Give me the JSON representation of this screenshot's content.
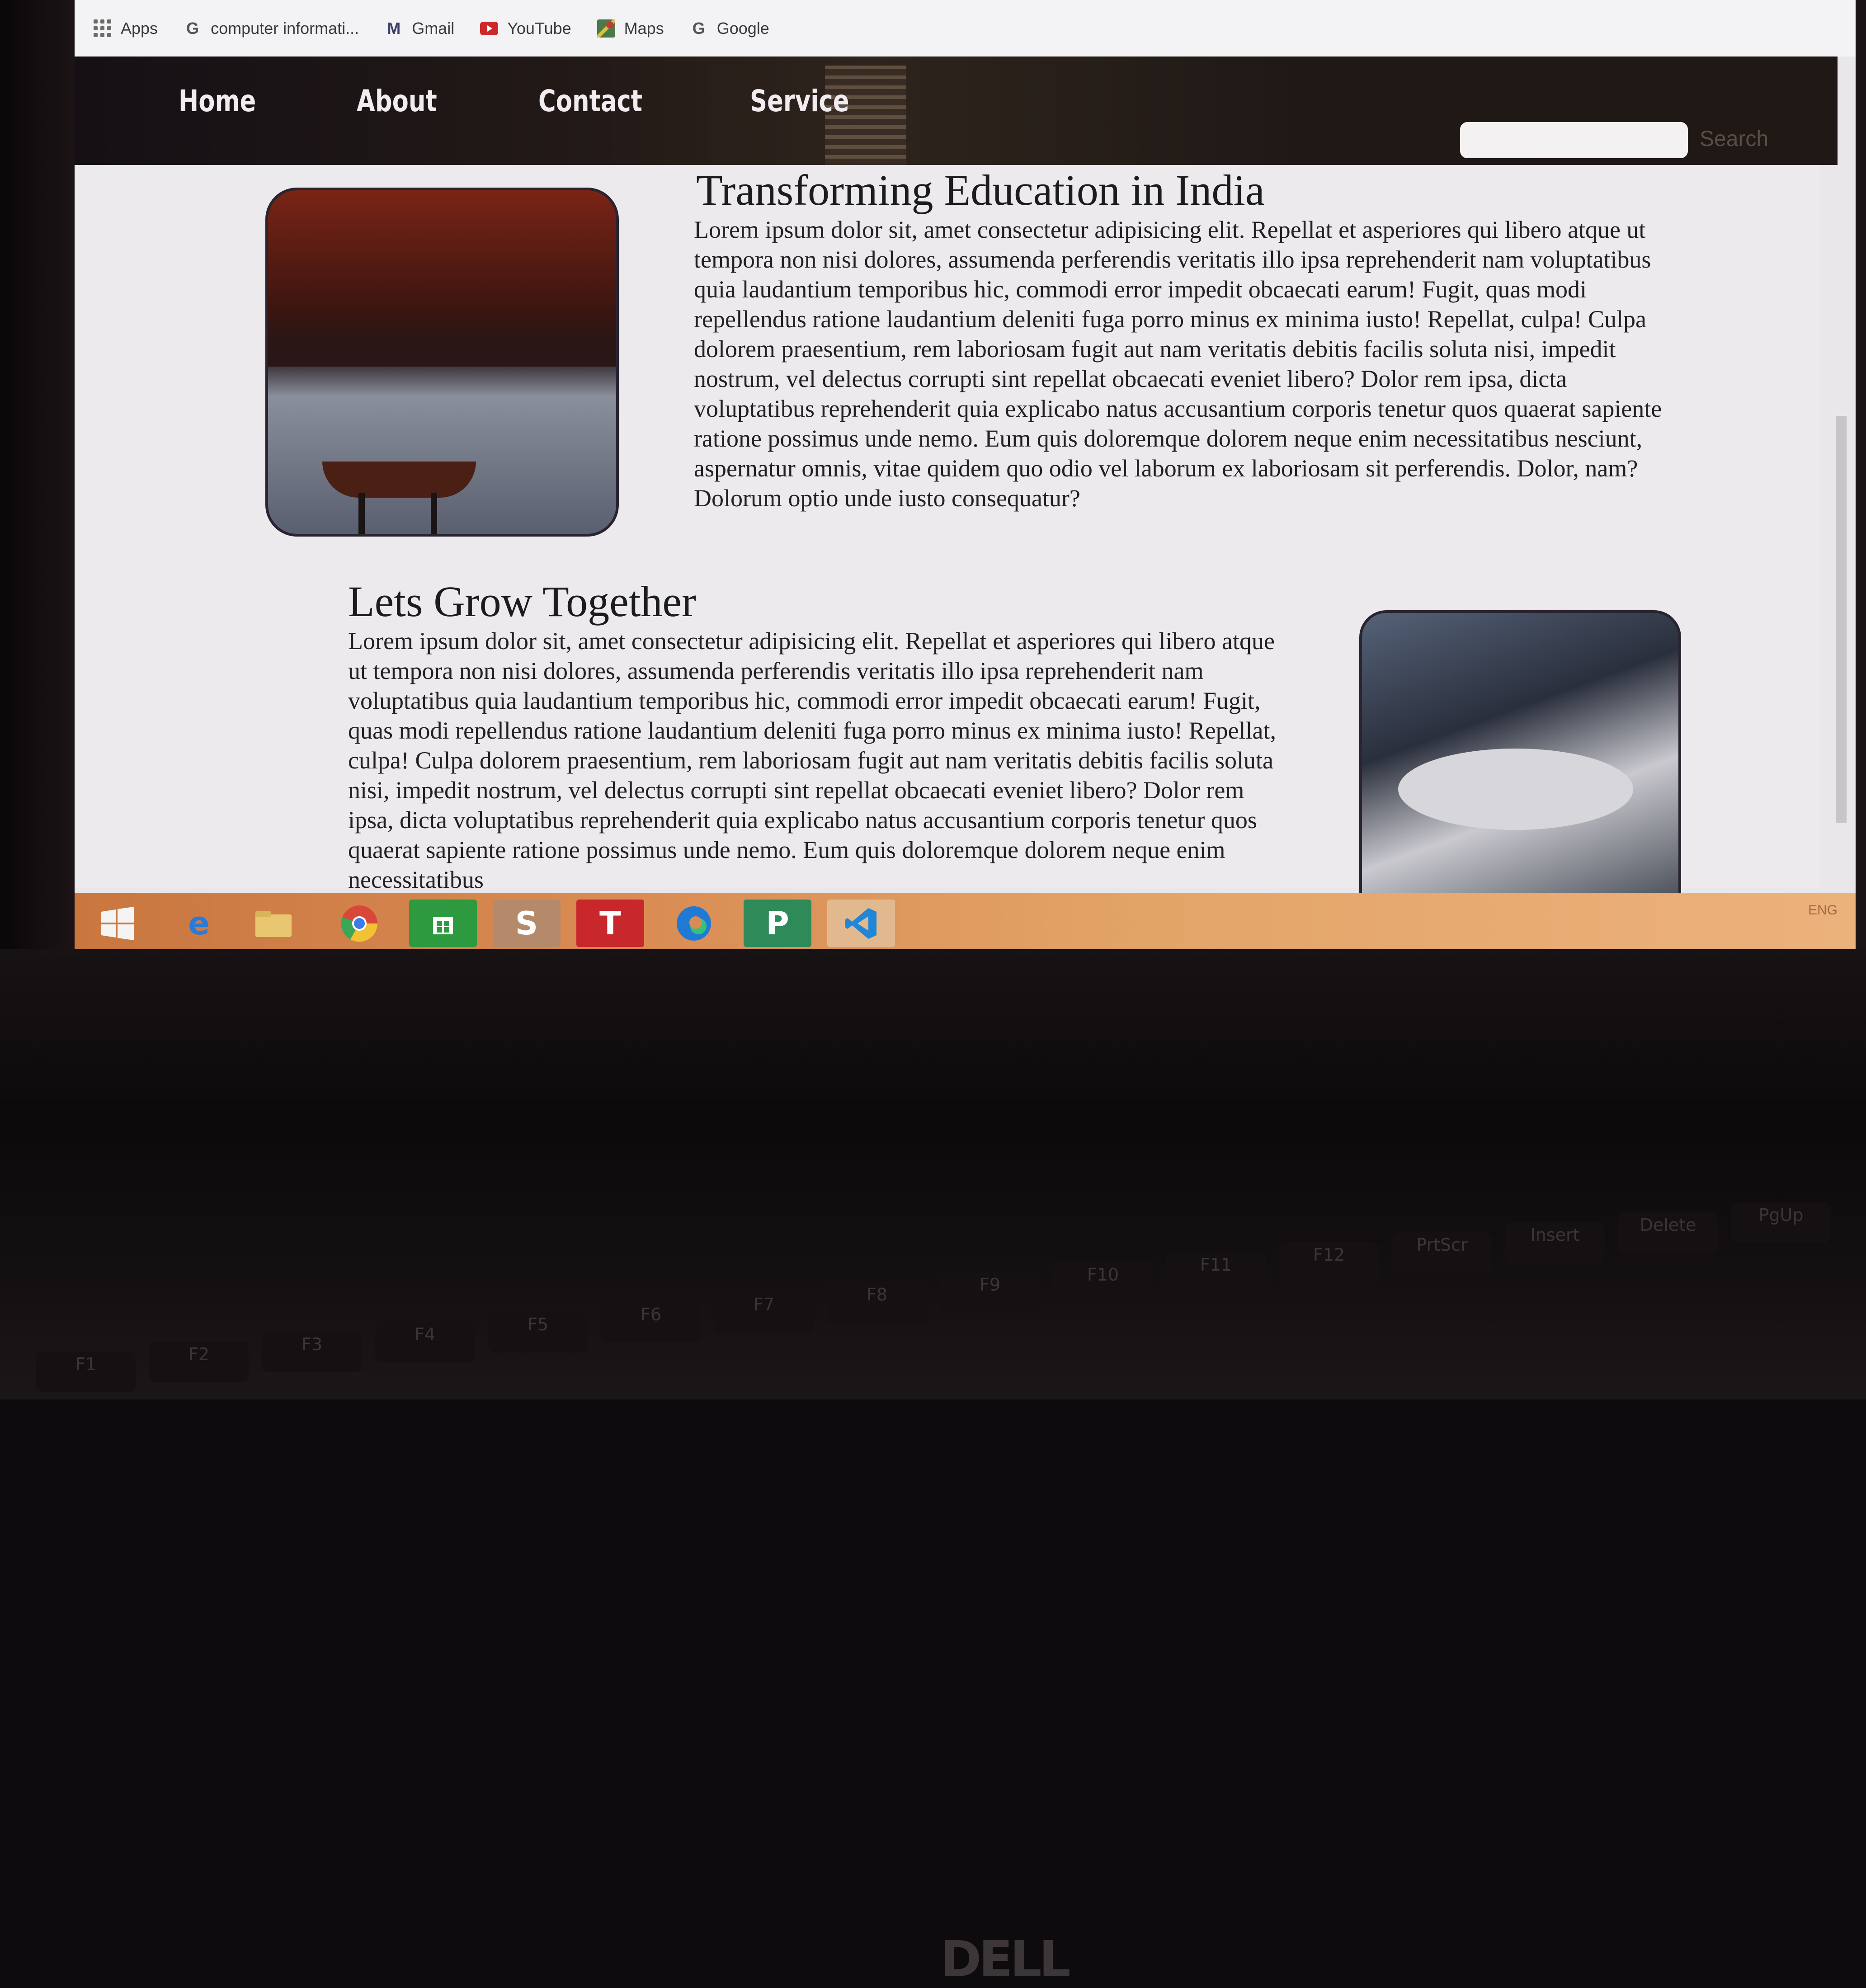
{
  "bookmarks": [
    {
      "label": "Apps",
      "icon": "apps-grid-icon"
    },
    {
      "label": "computer informati...",
      "icon": "google-g-icon"
    },
    {
      "label": "Gmail",
      "icon": "gmail-icon"
    },
    {
      "label": "YouTube",
      "icon": "youtube-icon"
    },
    {
      "label": "Maps",
      "icon": "maps-icon"
    },
    {
      "label": "Google",
      "icon": "google-g-icon"
    }
  ],
  "nav": {
    "home": "Home",
    "about": "About",
    "contact": "Contact",
    "service": "Service",
    "search_button": "Search"
  },
  "section1": {
    "title": "Transforming Education in India",
    "body": "Lorem ipsum dolor sit, amet consectetur adipisicing elit. Repellat et asperiores qui libero atque ut tempora non nisi dolores, assumenda perferendis veritatis illo ipsa reprehenderit nam voluptatibus quia laudantium temporibus hic, commodi error impedit obcaecati earum! Fugit, quas modi repellendus ratione laudantium deleniti fuga porro minus ex minima iusto! Repellat, culpa! Culpa dolorem praesentium, rem laboriosam fugit aut nam veritatis debitis facilis soluta nisi, impedit nostrum, vel delectus corrupti sint repellat obcaecati eveniet libero? Dolor rem ipsa, dicta voluptatibus reprehenderit quia explicabo natus accusantium corporis tenetur quos quaerat sapiente ratione possimus unde nemo. Eum quis doloremque dolorem neque enim necessitatibus nesciunt, aspernatur omnis, vitae quidem quo odio vel laborum ex laboriosam sit perferendis. Dolor, nam? Dolorum optio unde iusto consequatur?"
  },
  "section2": {
    "title": "Lets Grow Together",
    "body": "Lorem ipsum dolor sit, amet consectetur adipisicing elit. Repellat et asperiores qui libero atque ut tempora non nisi dolores, assumenda perferendis veritatis illo ipsa reprehenderit nam voluptatibus quia laudantium temporibus hic, commodi error impedit obcaecati earum! Fugit, quas modi repellendus ratione laudantium deleniti fuga porro minus ex minima iusto! Repellat, culpa! Culpa dolorem praesentium, rem laboriosam fugit aut nam veritatis debitis facilis soluta nisi, impedit nostrum, vel delectus corrupti sint repellat obcaecati eveniet libero? Dolor rem ipsa, dicta voluptatibus reprehenderit quia explicabo natus accusantium corporis tenetur quos quaerat sapiente ratione possimus unde nemo. Eum quis doloremque dolorem neque enim necessitatibus"
  },
  "taskbar": {
    "items": [
      {
        "name": "windows-start-icon",
        "glyph": ""
      },
      {
        "name": "internet-explorer-icon",
        "glyph": "e"
      },
      {
        "name": "file-explorer-icon",
        "glyph": ""
      },
      {
        "name": "chrome-icon",
        "glyph": ""
      },
      {
        "name": "store-icon",
        "glyph": ""
      },
      {
        "name": "sway-icon",
        "glyph": "S"
      },
      {
        "name": "typing-app-icon",
        "glyph": "T"
      },
      {
        "name": "edge-icon",
        "glyph": ""
      },
      {
        "name": "project-icon",
        "glyph": "P"
      },
      {
        "name": "vscode-icon",
        "glyph": ""
      }
    ],
    "tray_lang": "ENG"
  },
  "hardware": {
    "brand": "DELL",
    "fkeys": [
      "F1",
      "F2",
      "F3",
      "F4",
      "F5",
      "F6",
      "F7",
      "F8",
      "F9",
      "F10",
      "F11",
      "F12",
      "PrtScr",
      "Insert",
      "Delete",
      "PgUp"
    ]
  },
  "colors": {
    "header_bg": "#231a17",
    "nav_text": "#f1ecef",
    "taskbar": "#d88b52",
    "page_bg": "#eceaec"
  }
}
